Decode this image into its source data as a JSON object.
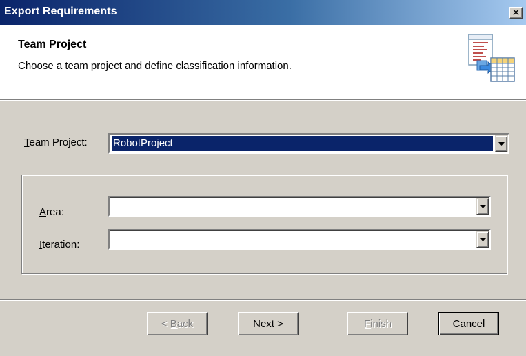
{
  "window": {
    "title": "Export Requirements",
    "close_glyph": "✕"
  },
  "header": {
    "title": "Team Project",
    "subtitle": "Choose a team project and define classification information.",
    "icon": "document-export-to-spreadsheet-icon"
  },
  "form": {
    "team_project": {
      "label_mnemonic": "T",
      "label_rest": "eam Project:",
      "value": "RobotProject"
    },
    "area": {
      "label_mnemonic": "A",
      "label_rest": "rea:",
      "value": ""
    },
    "iteration": {
      "label_mnemonic": "I",
      "label_rest": "teration:",
      "value": ""
    }
  },
  "buttons": {
    "back": {
      "prefix": "< ",
      "mnemonic": "B",
      "rest": "ack",
      "enabled": false
    },
    "next": {
      "mnemonic": "N",
      "rest": "ext >",
      "enabled": true
    },
    "finish": {
      "mnemonic": "F",
      "rest": "inish",
      "enabled": false
    },
    "cancel": {
      "mnemonic": "C",
      "rest": "ancel",
      "enabled": true
    }
  },
  "colors": {
    "dialog_face": "#d4d0c8",
    "titlebar_start": "#0a246a",
    "titlebar_end": "#a6caf0",
    "selection": "#0a246a"
  }
}
